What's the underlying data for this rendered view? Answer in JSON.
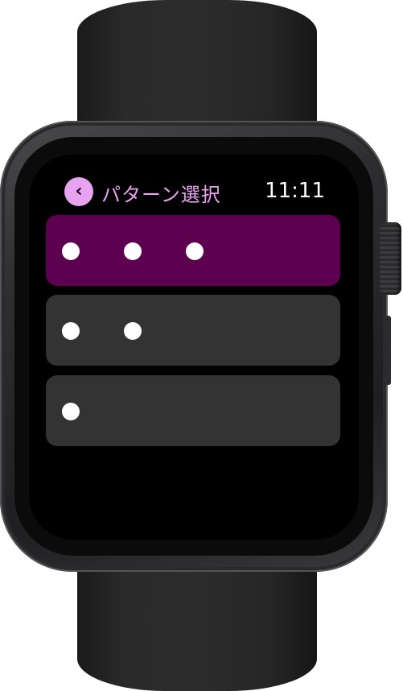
{
  "nav": {
    "back_icon": "chevron-left-icon",
    "title": "パターン選択",
    "time": "11:11"
  },
  "patterns": [
    {
      "label": "",
      "dots": 3,
      "selected": true
    },
    {
      "label": "",
      "dots": 2,
      "selected": false
    },
    {
      "label": "",
      "dots": 1,
      "selected": false
    }
  ],
  "colors": {
    "accent": "#e7a3ef",
    "selected_bg": "#5c004f",
    "row_bg": "#333333",
    "screen_bg": "#000000",
    "dot": "#ffffff"
  }
}
